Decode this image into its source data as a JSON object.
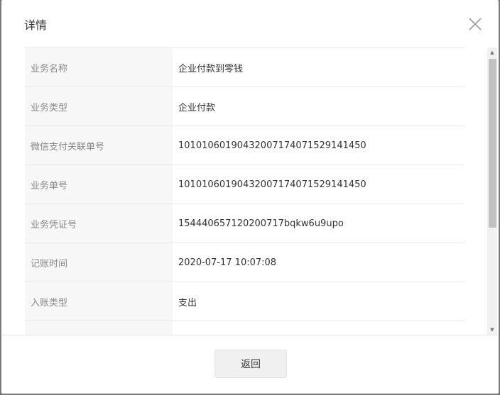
{
  "dialog": {
    "title": "详情",
    "close_icon": "close-icon",
    "back_label": "返回"
  },
  "details": [
    {
      "label": "业务名称",
      "value": "企业付款到零钱"
    },
    {
      "label": "业务类型",
      "value": "企业付款"
    },
    {
      "label": "微信支付关联单号",
      "value": "1010106019043200717407152914145​0"
    },
    {
      "label": "业务单号",
      "value": "10101060190432007174071529141450"
    },
    {
      "label": "业务凭证号",
      "value": "154440657120200717bqkw6u9upo"
    },
    {
      "label": "记账时间",
      "value": "2020-07-17 10:07:08"
    },
    {
      "label": "入账类型",
      "value": "支出"
    },
    {
      "label": "",
      "value": ""
    }
  ],
  "colors": {
    "overlay": "#7a7a7a",
    "label_bg": "#f7f7f7",
    "button_bg": "#f0f0f0"
  }
}
